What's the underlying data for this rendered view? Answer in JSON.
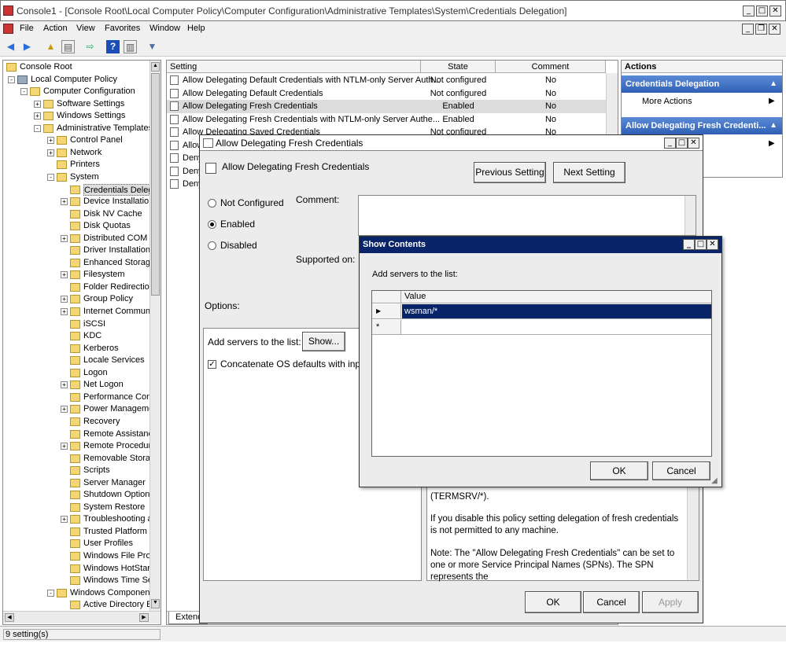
{
  "window": {
    "title": "Console1 - [Console Root\\Local Computer Policy\\Computer Configuration\\Administrative Templates\\System\\Credentials Delegation]"
  },
  "menu": [
    "File",
    "Action",
    "View",
    "Favorites",
    "Window",
    "Help"
  ],
  "tree": {
    "nodes": [
      "Console Root",
      "Local Computer Policy",
      "Computer Configuration",
      "Software Settings",
      "Windows Settings",
      "Administrative Templates",
      "Control Panel",
      "Network",
      "Printers",
      "System",
      "Credentials Deleg",
      "Device Installatio",
      "Disk NV Cache",
      "Disk Quotas",
      "Distributed COM",
      "Driver Installation",
      "Enhanced Storag",
      "Filesystem",
      "Folder Redirectio",
      "Group Policy",
      "Internet Commun",
      "iSCSI",
      "KDC",
      "Kerberos",
      "Locale Services",
      "Logon",
      "Net Logon",
      "Performance Con",
      "Power Manageme",
      "Recovery",
      "Remote Assistanc",
      "Remote Procedur",
      "Removable Stora",
      "Scripts",
      "Server Manager",
      "Shutdown Option",
      "System Restore",
      "Troubleshooting a",
      "Trusted Platform",
      "User Profiles",
      "Windows File Prot",
      "Windows HotStar",
      "Windows Time Se",
      "Windows Component",
      "Active Directory E"
    ]
  },
  "list": {
    "headers": {
      "setting": "Setting",
      "state": "State",
      "comment": "Comment"
    },
    "rows": [
      {
        "setting": "Allow Delegating Default Credentials with NTLM-only Server Auth...",
        "state": "Not configured",
        "comment": "No"
      },
      {
        "setting": "Allow Delegating Default Credentials",
        "state": "Not configured",
        "comment": "No"
      },
      {
        "setting": "Allow Delegating Fresh Credentials",
        "state": "Enabled",
        "comment": "No"
      },
      {
        "setting": "Allow Delegating Fresh Credentials with NTLM-only Server Authe...",
        "state": "Enabled",
        "comment": "No"
      },
      {
        "setting": "Allow Delegating Saved Credentials",
        "state": "Not configured",
        "comment": "No"
      },
      {
        "setting": "Allow",
        "state": "",
        "comment": ""
      },
      {
        "setting": "Deny",
        "state": "",
        "comment": ""
      },
      {
        "setting": "Deny",
        "state": "",
        "comment": ""
      },
      {
        "setting": "Deny",
        "state": "",
        "comment": ""
      }
    ],
    "tab": "Extend"
  },
  "actions": {
    "header": "Actions",
    "section1": "Credentials Delegation",
    "more": "More Actions",
    "section2": "Allow Delegating Fresh Credenti..."
  },
  "status": "9 setting(s)",
  "dialog": {
    "title": "Allow Delegating Fresh Credentials",
    "heading": "Allow Delegating Fresh Credentials",
    "prev": "Previous Setting",
    "next": "Next Setting",
    "opt_not": "Not Configured",
    "opt_enabled": "Enabled",
    "opt_disabled": "Disabled",
    "comment_label": "Comment:",
    "supported_label": "Supported on:",
    "options_label": "Options:",
    "add_servers": "Add servers to the list:",
    "show_btn": "Show...",
    "concat": "Concatenate OS defaults with input a",
    "help1": "(TERMSRV/*).",
    "help2": "If you disable this policy setting delegation of fresh credentials is not permitted to any machine.",
    "help3": "Note: The \"Allow Delegating Fresh Credentials\" can be set to one or more Service Principal Names (SPNs).  The SPN represents the",
    "ok": "OK",
    "cancel": "Cancel",
    "apply": "Apply"
  },
  "show": {
    "title": "Show Contents",
    "prompt": "Add servers to the list:",
    "col": "Value",
    "row1": "wsman/*",
    "newrow": "*",
    "ok": "OK",
    "cancel": "Cancel"
  }
}
